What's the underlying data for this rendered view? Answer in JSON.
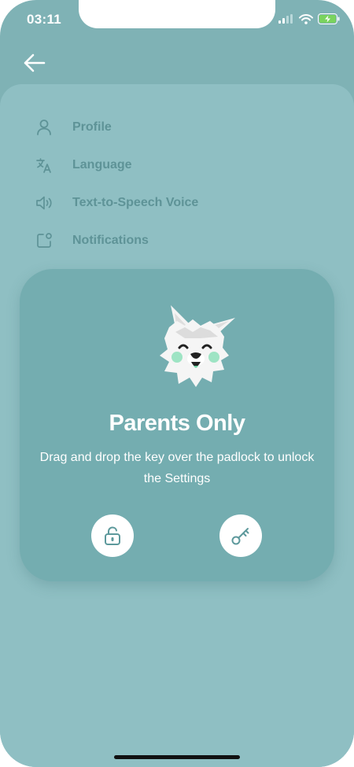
{
  "status_bar": {
    "time": "03:11"
  },
  "header": {
    "back_icon": "arrow-left-icon"
  },
  "menu": {
    "items": [
      {
        "label": "Profile",
        "icon": "user-icon"
      },
      {
        "label": "Language",
        "icon": "translate-icon"
      },
      {
        "label": "Text-to-Speech Voice",
        "icon": "speaker-icon"
      },
      {
        "label": "Notifications",
        "icon": "notification-icon"
      }
    ]
  },
  "parents_gate": {
    "title": "Parents Only",
    "description": "Drag and drop the key over the padlock to unlock the Settings",
    "padlock_icon": "padlock-icon",
    "key_icon": "key-icon"
  },
  "colors": {
    "background": "#7fb2b5",
    "sheet": "#8fbfc3",
    "card": "#74adb0",
    "menu_text": "#5e9397",
    "accent": "#5d999c"
  }
}
